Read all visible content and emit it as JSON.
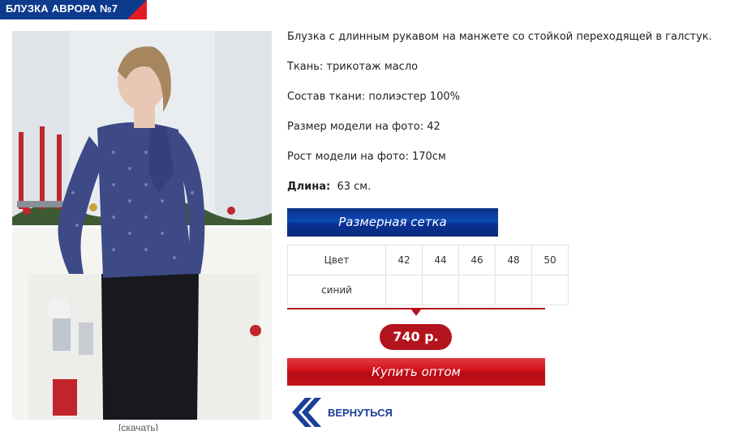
{
  "product": {
    "title": "БЛУЗКА АВРОРА №7",
    "zoom_link": "[скачать]",
    "description": "Блузка с длинным рукавом на манжете со стойкой переходящей в галстук.",
    "fabric": "Ткань: трикотаж масло",
    "composition": "Состав ткани: полиэстер 100%",
    "model_size": "Размер модели на фото: 42",
    "model_height": "Рост модели на фото: 170см",
    "length_label": "Длина:",
    "length_value": "63 см."
  },
  "size_chart_button": "Размерная сетка",
  "size_table": {
    "header": [
      "Цвет",
      "42",
      "44",
      "46",
      "48",
      "50"
    ],
    "rows": [
      [
        "синий",
        "",
        "",
        "",
        "",
        ""
      ]
    ]
  },
  "price": "740 р.",
  "buy_button": "Купить оптом",
  "back_label": "ВЕРНУТЬСЯ",
  "colors": {
    "brand_blue": "#0d3a8c",
    "accent_red": "#b3131c",
    "blouse": "#3d4a86"
  },
  "icons": {
    "back": "double-chevron-left-icon"
  }
}
